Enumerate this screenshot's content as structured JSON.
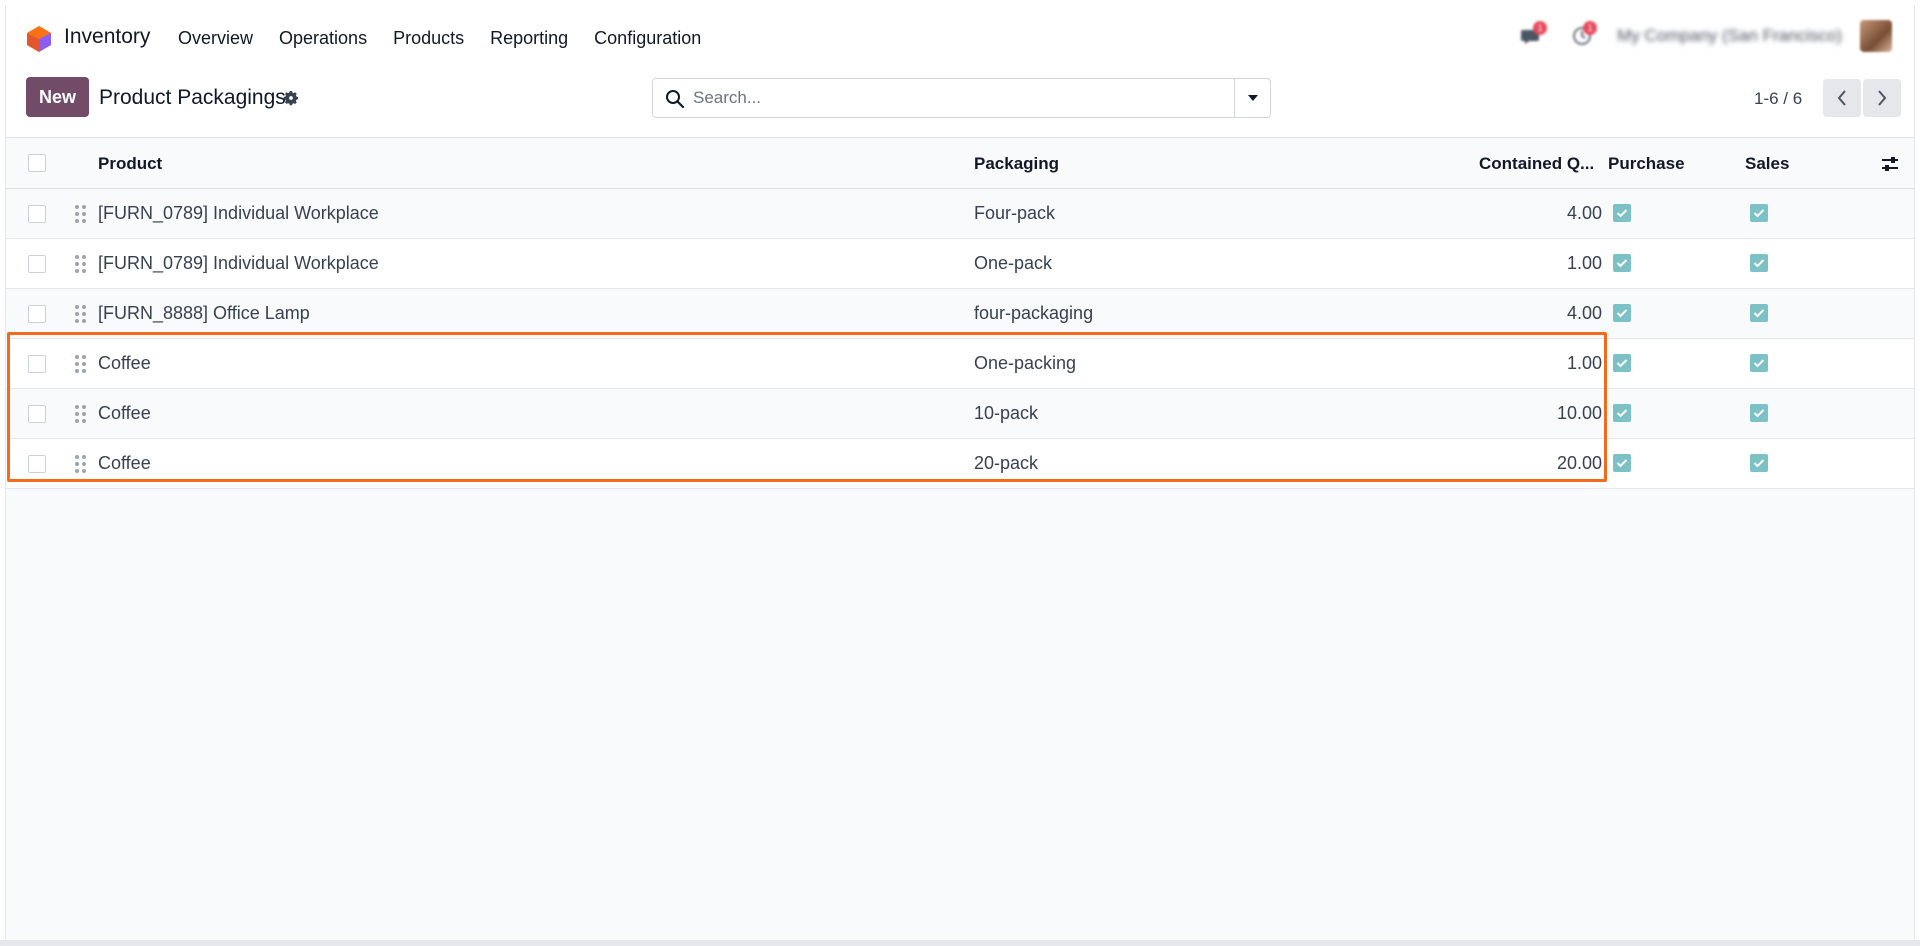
{
  "app": {
    "name": "Inventory",
    "menu": [
      "Overview",
      "Operations",
      "Products",
      "Reporting",
      "Configuration"
    ],
    "company": "My Company (San Francisco)",
    "messages_count": "1",
    "activities_count": "1"
  },
  "control_panel": {
    "new_label": "New",
    "title": "Product Packagings",
    "search_placeholder": "Search...",
    "pager": "1-6 / 6"
  },
  "table": {
    "headers": {
      "product": "Product",
      "packaging": "Packaging",
      "qty": "Contained Q...",
      "purchase": "Purchase",
      "sales": "Sales"
    },
    "rows": [
      {
        "product": "[FURN_0789] Individual Workplace",
        "packaging": "Four-pack",
        "qty": "4.00",
        "purchase": true,
        "sales": true
      },
      {
        "product": "[FURN_0789] Individual Workplace",
        "packaging": "One-pack",
        "qty": "1.00",
        "purchase": true,
        "sales": true
      },
      {
        "product": "[FURN_8888] Office Lamp",
        "packaging": "four-packaging",
        "qty": "4.00",
        "purchase": true,
        "sales": true
      },
      {
        "product": "Coffee",
        "packaging": "One-packing",
        "qty": "1.00",
        "purchase": true,
        "sales": true
      },
      {
        "product": "Coffee",
        "packaging": "10-pack",
        "qty": "10.00",
        "purchase": true,
        "sales": true
      },
      {
        "product": "Coffee",
        "packaging": "20-pack",
        "qty": "20.00",
        "purchase": true,
        "sales": true
      }
    ]
  },
  "colors": {
    "primary": "#714b67",
    "highlight": "#f26b1d",
    "checkbox_checked": "#7cc1c5"
  }
}
